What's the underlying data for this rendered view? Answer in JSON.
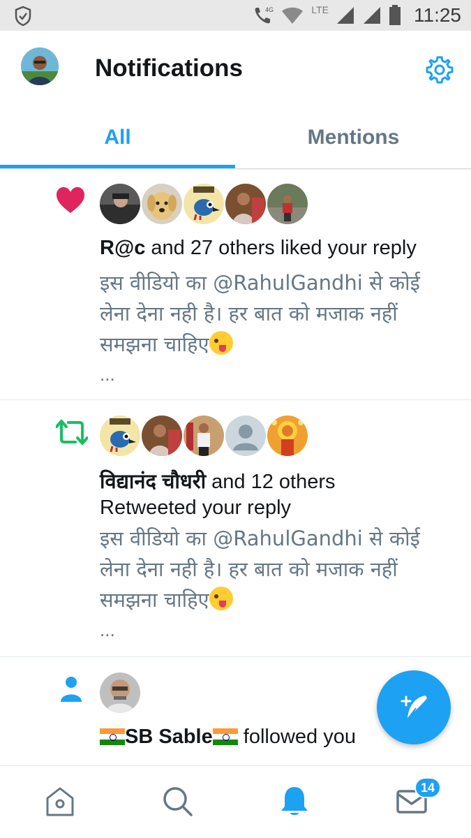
{
  "status_bar": {
    "network": "4G",
    "lte": "LTE",
    "time": "11:25"
  },
  "header": {
    "title": "Notifications"
  },
  "tabs": [
    {
      "label": "All",
      "active": true
    },
    {
      "label": "Mentions",
      "active": false
    }
  ],
  "notifications": [
    {
      "type": "like",
      "actor": "R@c",
      "action": " and 27 others liked your reply",
      "tweet_text": "इस वीडियो का @RahulGandhi से कोई लेना देना नही है। हर बात को मजाक नहीं समझना चाहिए",
      "ellipsis": "..."
    },
    {
      "type": "retweet",
      "actor": "विद्यानंद चौधरी",
      "action": " and 12 others",
      "action_line2": "Retweeted your reply",
      "tweet_text": "इस वीडियो का @RahulGandhi से कोई लेना देना नही है। हर बात को मजाक नहीं समझना चाहिए",
      "ellipsis": "..."
    },
    {
      "type": "follow",
      "actor": "SB Sable",
      "action": " followed you"
    }
  ],
  "bottom_nav": {
    "messages_badge": "14"
  },
  "colors": {
    "accent": "#1da1f2",
    "like": "#e0245e",
    "retweet": "#17bf63",
    "secondary_text": "#657786"
  }
}
